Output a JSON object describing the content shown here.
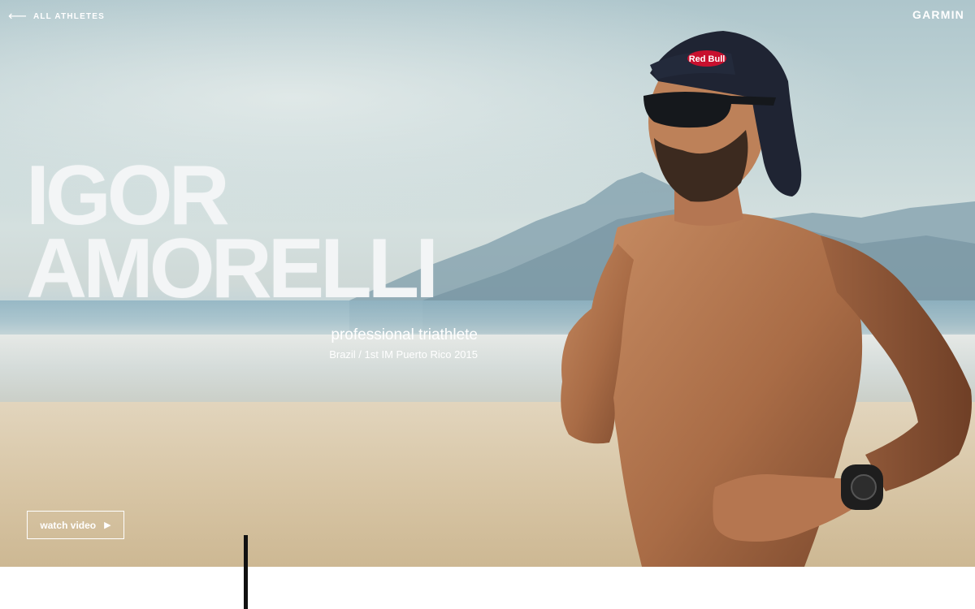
{
  "nav": {
    "back_icon": "arrow-left-icon",
    "back_label": "ALL ATHLETES"
  },
  "brand": {
    "logo": "GARMIN"
  },
  "hero": {
    "first_name": "IGOR",
    "last_name": "AMORELLI",
    "role": "professional triathlete",
    "meta": "Brazil / 1st IM Puerto Rico 2015",
    "cap_logo_text": "Red Bull",
    "watch_button_label": "watch video",
    "watch_button_icon": "play-icon",
    "play_glyph": "▶"
  },
  "colors": {
    "text_on_hero": "#ffffff",
    "divider": "#111111"
  }
}
